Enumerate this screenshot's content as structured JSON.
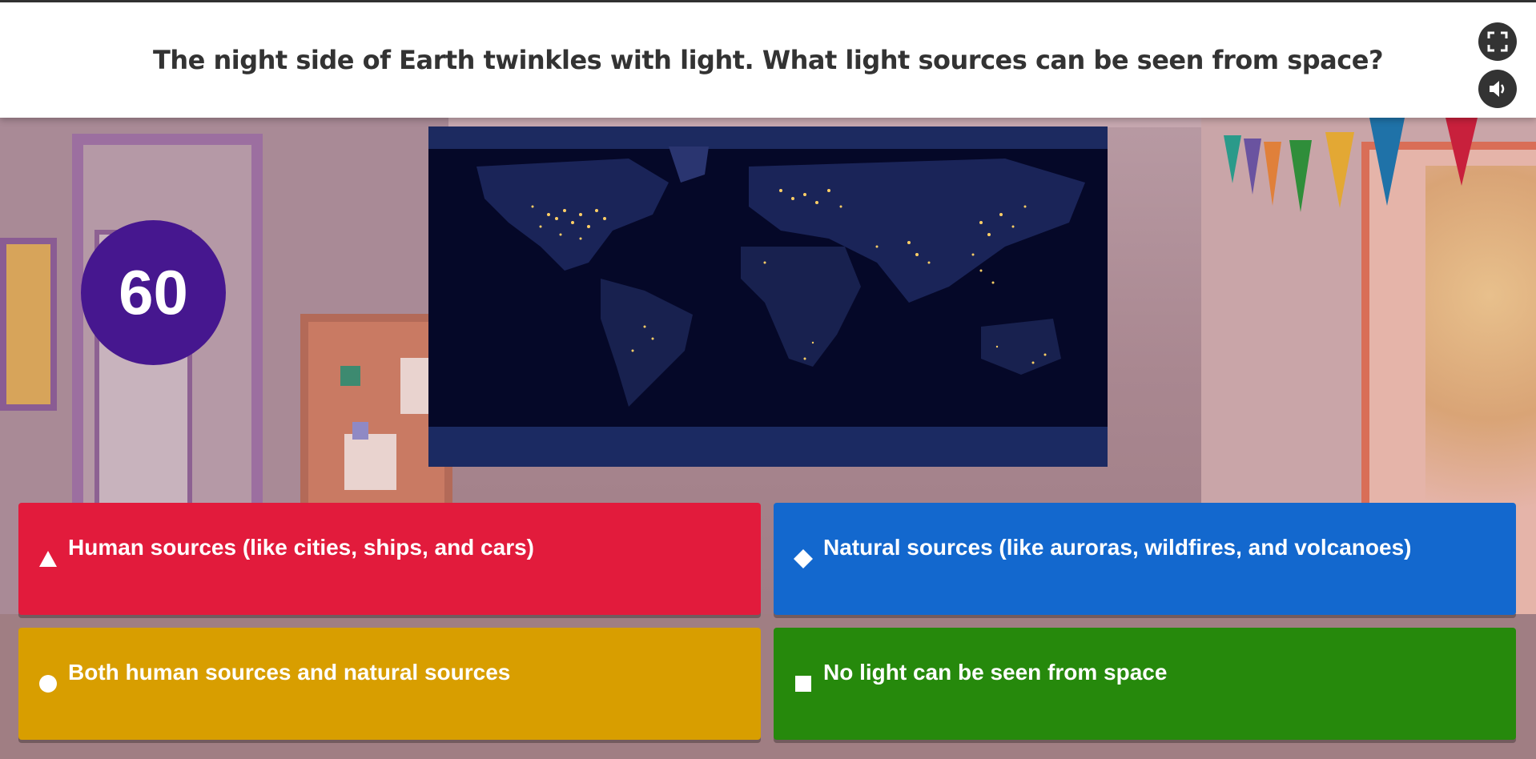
{
  "question": {
    "text": "The night side of Earth twinkles with light. What light sources can be seen from space?"
  },
  "controls": {
    "fullscreen_icon": "fullscreen-icon",
    "sound_icon": "speaker-icon"
  },
  "timer": {
    "value": "60",
    "color": "#46178f"
  },
  "image": {
    "subject": "world map at night"
  },
  "answers": [
    {
      "shape": "triangle",
      "label": "Human sources (like cities, ships, and cars)",
      "color": "#e21b3c"
    },
    {
      "shape": "diamond",
      "label": "Natural sources (like auroras, wildfires, and volcanoes)",
      "color": "#1368ce"
    },
    {
      "shape": "circle",
      "label": "Both human sources and natural sources",
      "color": "#d89e00"
    },
    {
      "shape": "square",
      "label": "No light can be seen from space",
      "color": "#26890c"
    }
  ]
}
